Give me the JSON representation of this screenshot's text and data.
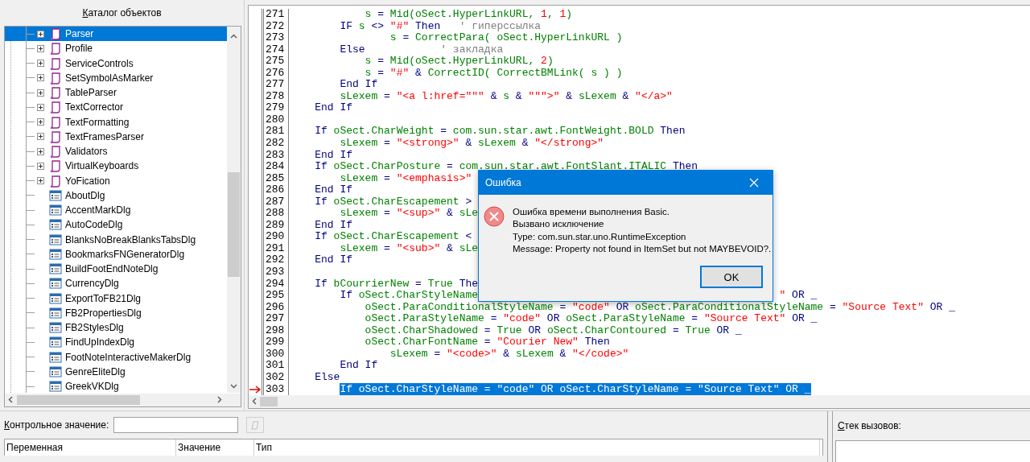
{
  "catalog": {
    "title": "Каталог объектов",
    "items": [
      {
        "label": "Parser",
        "kind": "module",
        "expanded": false,
        "selected": true
      },
      {
        "label": "Profile",
        "kind": "module",
        "expanded": false,
        "selected": false
      },
      {
        "label": "ServiceControls",
        "kind": "module",
        "expanded": false,
        "selected": false
      },
      {
        "label": "SetSymbolAsMarker",
        "kind": "module",
        "expanded": false,
        "selected": false
      },
      {
        "label": "TableParser",
        "kind": "module",
        "expanded": false,
        "selected": false
      },
      {
        "label": "TextCorrector",
        "kind": "module",
        "expanded": false,
        "selected": false
      },
      {
        "label": "TextFormatting",
        "kind": "module",
        "expanded": false,
        "selected": false
      },
      {
        "label": "TextFramesParser",
        "kind": "module",
        "expanded": false,
        "selected": false
      },
      {
        "label": "Validators",
        "kind": "module",
        "expanded": false,
        "selected": false
      },
      {
        "label": "VirtualKeyboards",
        "kind": "module",
        "expanded": false,
        "selected": false
      },
      {
        "label": "YoFication",
        "kind": "module",
        "expanded": false,
        "selected": false
      },
      {
        "label": "AboutDlg",
        "kind": "dialog",
        "selected": false
      },
      {
        "label": "AccentMarkDlg",
        "kind": "dialog",
        "selected": false
      },
      {
        "label": "AutoCodeDlg",
        "kind": "dialog",
        "selected": false
      },
      {
        "label": "BlanksNoBreakBlanksTabsDlg",
        "kind": "dialog",
        "selected": false
      },
      {
        "label": "BookmarksFNGeneratorDlg",
        "kind": "dialog",
        "selected": false
      },
      {
        "label": "BuildFootEndNoteDlg",
        "kind": "dialog",
        "selected": false
      },
      {
        "label": "CurrencyDlg",
        "kind": "dialog",
        "selected": false
      },
      {
        "label": "ExportToFB21Dlg",
        "kind": "dialog",
        "selected": false
      },
      {
        "label": "FB2PropertiesDlg",
        "kind": "dialog",
        "selected": false
      },
      {
        "label": "FB2StylesDlg",
        "kind": "dialog",
        "selected": false
      },
      {
        "label": "FindUpIndexDlg",
        "kind": "dialog",
        "selected": false
      },
      {
        "label": "FootNoteInteractiveMakerDlg",
        "kind": "dialog",
        "selected": false
      },
      {
        "label": "GenreEliteDlg",
        "kind": "dialog",
        "selected": false
      },
      {
        "label": "GreekVKDlg",
        "kind": "dialog",
        "selected": false
      }
    ]
  },
  "editor": {
    "lines": [
      {
        "number": "271",
        "current": false,
        "tokens": [
          {
            "kind": "id",
            "text": "            s"
          },
          {
            "kind": "op",
            "text": " = "
          },
          {
            "kind": "id",
            "text": "Mid(oSect.HyperLinkURL, "
          },
          {
            "kind": "num",
            "text": "1"
          },
          {
            "kind": "id",
            "text": ", "
          },
          {
            "kind": "num",
            "text": "1"
          },
          {
            "kind": "id",
            "text": ")"
          }
        ]
      },
      {
        "number": "272",
        "current": false,
        "tokens": [
          {
            "kind": "kw",
            "text": "        IF"
          },
          {
            "kind": "id",
            "text": " s"
          },
          {
            "kind": "op",
            "text": " <> "
          },
          {
            "kind": "str",
            "text": "\"#\""
          },
          {
            "kind": "kw",
            "text": " Then"
          },
          {
            "kind": "cm",
            "text": "   ' гиперссылка"
          }
        ]
      },
      {
        "number": "273",
        "current": false,
        "tokens": [
          {
            "kind": "id",
            "text": "                s"
          },
          {
            "kind": "op",
            "text": " = "
          },
          {
            "kind": "id",
            "text": "CorrectPara( oSect.HyperLinkURL )"
          }
        ]
      },
      {
        "number": "274",
        "current": false,
        "tokens": [
          {
            "kind": "kw",
            "text": "        Else"
          },
          {
            "kind": "cm",
            "text": "            ' закладка"
          }
        ]
      },
      {
        "number": "275",
        "current": false,
        "tokens": [
          {
            "kind": "id",
            "text": "            s"
          },
          {
            "kind": "op",
            "text": " = "
          },
          {
            "kind": "id",
            "text": "Mid(oSect.HyperLinkURL, "
          },
          {
            "kind": "num",
            "text": "2"
          },
          {
            "kind": "id",
            "text": ")"
          }
        ]
      },
      {
        "number": "276",
        "current": false,
        "tokens": [
          {
            "kind": "id",
            "text": "            s"
          },
          {
            "kind": "op",
            "text": " = "
          },
          {
            "kind": "str",
            "text": "\"#\""
          },
          {
            "kind": "op",
            "text": " & "
          },
          {
            "kind": "id",
            "text": "CorrectID( CorrectBMLink( s ) )"
          }
        ]
      },
      {
        "number": "277",
        "current": false,
        "tokens": [
          {
            "kind": "kw",
            "text": "        End If"
          }
        ]
      },
      {
        "number": "278",
        "current": false,
        "tokens": [
          {
            "kind": "id",
            "text": "        sLexem"
          },
          {
            "kind": "op",
            "text": " = "
          },
          {
            "kind": "str",
            "text": "\"<a l:href=\"\"\""
          },
          {
            "kind": "op",
            "text": " & "
          },
          {
            "kind": "id",
            "text": "s"
          },
          {
            "kind": "op",
            "text": " & "
          },
          {
            "kind": "str",
            "text": "\"\"\">\""
          },
          {
            "kind": "op",
            "text": " & "
          },
          {
            "kind": "id",
            "text": "sLexem"
          },
          {
            "kind": "op",
            "text": " & "
          },
          {
            "kind": "str",
            "text": "\"</a>\""
          }
        ]
      },
      {
        "number": "279",
        "current": false,
        "tokens": [
          {
            "kind": "kw",
            "text": "    End If"
          }
        ]
      },
      {
        "number": "280",
        "current": false
      },
      {
        "number": "281",
        "current": false,
        "tokens": [
          {
            "kind": "kw",
            "text": "    If"
          },
          {
            "kind": "id",
            "text": " oSect.CharWeight"
          },
          {
            "kind": "op",
            "text": " = "
          },
          {
            "kind": "id",
            "text": "com.sun.star.awt.FontWeight.BOLD"
          },
          {
            "kind": "kw",
            "text": " Then"
          }
        ]
      },
      {
        "number": "282",
        "current": false,
        "tokens": [
          {
            "kind": "id",
            "text": "        sLexem"
          },
          {
            "kind": "op",
            "text": " = "
          },
          {
            "kind": "str",
            "text": "\"<strong>\""
          },
          {
            "kind": "op",
            "text": " & "
          },
          {
            "kind": "id",
            "text": "sLexem"
          },
          {
            "kind": "op",
            "text": " & "
          },
          {
            "kind": "str",
            "text": "\"</strong>\""
          }
        ]
      },
      {
        "number": "283",
        "current": false,
        "tokens": [
          {
            "kind": "kw",
            "text": "    End If"
          }
        ]
      },
      {
        "number": "284",
        "current": false,
        "tokens": [
          {
            "kind": "kw",
            "text": "    If"
          },
          {
            "kind": "id",
            "text": " oSect.CharPosture"
          },
          {
            "kind": "op",
            "text": " = "
          },
          {
            "kind": "id",
            "text": "com.sun.star.awt.FontSlant.ITALIC"
          },
          {
            "kind": "kw",
            "text": " Then"
          }
        ]
      },
      {
        "number": "285",
        "current": false,
        "tokens": [
          {
            "kind": "id",
            "text": "        sLexem"
          },
          {
            "kind": "op",
            "text": " = "
          },
          {
            "kind": "str",
            "text": "\"<emphasis>\""
          }
        ]
      },
      {
        "number": "286",
        "current": false,
        "tokens": [
          {
            "kind": "kw",
            "text": "    End If"
          }
        ]
      },
      {
        "number": "287",
        "current": false,
        "tokens": [
          {
            "kind": "kw",
            "text": "    If"
          },
          {
            "kind": "id",
            "text": " oSect.CharEscapement"
          },
          {
            "kind": "op",
            "text": " >"
          }
        ]
      },
      {
        "number": "288",
        "current": false,
        "tokens": [
          {
            "kind": "id",
            "text": "        sLexem"
          },
          {
            "kind": "op",
            "text": " = "
          },
          {
            "kind": "str",
            "text": "\"<sup>\""
          },
          {
            "kind": "op",
            "text": " & "
          },
          {
            "kind": "id",
            "text": "sLe"
          }
        ]
      },
      {
        "number": "289",
        "current": false,
        "tokens": [
          {
            "kind": "kw",
            "text": "    End If"
          }
        ]
      },
      {
        "number": "290",
        "current": false,
        "tokens": [
          {
            "kind": "kw",
            "text": "    If"
          },
          {
            "kind": "id",
            "text": " oSect.CharEscapement"
          },
          {
            "kind": "op",
            "text": " <"
          }
        ]
      },
      {
        "number": "291",
        "current": false,
        "tokens": [
          {
            "kind": "id",
            "text": "        sLexem"
          },
          {
            "kind": "op",
            "text": " = "
          },
          {
            "kind": "str",
            "text": "\"<sub>\""
          },
          {
            "kind": "op",
            "text": " & "
          },
          {
            "kind": "id",
            "text": "sLe"
          }
        ]
      },
      {
        "number": "292",
        "current": false,
        "tokens": [
          {
            "kind": "kw",
            "text": "    End If"
          }
        ]
      },
      {
        "number": "293",
        "current": false
      },
      {
        "number": "294",
        "current": false,
        "tokens": [
          {
            "kind": "kw",
            "text": "    If"
          },
          {
            "kind": "id",
            "text": " bCourrierNew"
          },
          {
            "kind": "op",
            "text": " = "
          },
          {
            "kind": "id",
            "text": "True"
          },
          {
            "kind": "kw",
            "text": " The"
          }
        ]
      },
      {
        "number": "295",
        "current": false,
        "tokens": [
          {
            "kind": "kw",
            "text": "        If"
          },
          {
            "kind": "id",
            "text": " oSect.CharStyleName"
          }
        ],
        "tail_tokens": [
          {
            "kind": "str",
            "text": "\""
          },
          {
            "kind": "kw",
            "text": " OR _"
          }
        ]
      },
      {
        "number": "296",
        "current": false,
        "tokens": [
          {
            "kind": "id",
            "text": "            oSect.ParaConditionalStyleName"
          },
          {
            "kind": "op",
            "text": " = "
          },
          {
            "kind": "str",
            "text": "\"code\""
          },
          {
            "kind": "kw",
            "text": " OR "
          },
          {
            "kind": "id",
            "text": "oSect.ParaConditionalStyleName"
          },
          {
            "kind": "op",
            "text": " = "
          },
          {
            "kind": "str",
            "text": "\"Source Text\""
          },
          {
            "kind": "kw",
            "text": " OR _"
          }
        ]
      },
      {
        "number": "297",
        "current": false,
        "tokens": [
          {
            "kind": "id",
            "text": "            oSect.ParaStyleName"
          },
          {
            "kind": "op",
            "text": " = "
          },
          {
            "kind": "str",
            "text": "\"code\""
          },
          {
            "kind": "kw",
            "text": " OR "
          },
          {
            "kind": "id",
            "text": "oSect.ParaStyleName"
          },
          {
            "kind": "op",
            "text": " = "
          },
          {
            "kind": "str",
            "text": "\"Source Text\""
          },
          {
            "kind": "kw",
            "text": " OR _"
          }
        ]
      },
      {
        "number": "298",
        "current": false,
        "tokens": [
          {
            "kind": "id",
            "text": "            oSect.CharShadowed"
          },
          {
            "kind": "op",
            "text": " = "
          },
          {
            "kind": "id",
            "text": "True"
          },
          {
            "kind": "kw",
            "text": " OR "
          },
          {
            "kind": "id",
            "text": "oSect.CharContoured"
          },
          {
            "kind": "op",
            "text": " = "
          },
          {
            "kind": "id",
            "text": "True"
          },
          {
            "kind": "kw",
            "text": " OR _"
          }
        ]
      },
      {
        "number": "299",
        "current": false,
        "tokens": [
          {
            "kind": "id",
            "text": "            oSect.CharFontName"
          },
          {
            "kind": "op",
            "text": " = "
          },
          {
            "kind": "str",
            "text": "\"Courier New\""
          },
          {
            "kind": "kw",
            "text": " Then"
          }
        ]
      },
      {
        "number": "300",
        "current": false,
        "tokens": [
          {
            "kind": "id",
            "text": "                sLexem"
          },
          {
            "kind": "op",
            "text": " = "
          },
          {
            "kind": "str",
            "text": "\"<code>\""
          },
          {
            "kind": "op",
            "text": " & "
          },
          {
            "kind": "id",
            "text": "sLexem"
          },
          {
            "kind": "op",
            "text": " & "
          },
          {
            "kind": "str",
            "text": "\"</code>\""
          }
        ]
      },
      {
        "number": "301",
        "current": false,
        "tokens": [
          {
            "kind": "kw",
            "text": "        End If"
          }
        ]
      },
      {
        "number": "302",
        "current": false,
        "tokens": [
          {
            "kind": "kw",
            "text": "    Else"
          }
        ]
      },
      {
        "number": "303",
        "current": true,
        "tokens": [
          {
            "kind": "sel",
            "text": "If oSect.CharStyleName = \"code\" OR oSect.CharStyleName = \"Source Text\" OR _"
          }
        ]
      }
    ]
  },
  "dialog": {
    "title": "Ошибка",
    "messages": [
      "Ошибка времени выполнения Basic.",
      "Вызвано исключение",
      "Type: com.sun.star.uno.RuntimeException",
      "Message: Property not found in ItemSet but not MAYBEVOID?."
    ],
    "button": "OK"
  },
  "watch": {
    "label": "Контрольное значение:",
    "columns": [
      "Переменная",
      "Значение",
      "Тип"
    ]
  },
  "call_stack": {
    "label": "Стек вызовов:"
  }
}
